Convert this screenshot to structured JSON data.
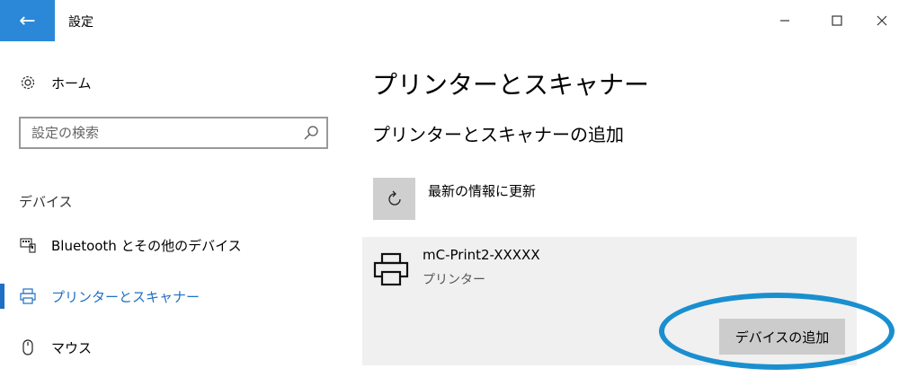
{
  "window": {
    "title": "設定",
    "back_icon": "back-arrow-icon",
    "minimize_icon": "minimize-icon",
    "maximize_icon": "maximize-icon",
    "close_icon": "close-icon"
  },
  "sidebar": {
    "home": {
      "icon": "gear-icon",
      "label": "ホーム"
    },
    "search": {
      "placeholder": "設定の検索",
      "icon": "search-icon"
    },
    "section_label": "デバイス",
    "items": [
      {
        "icon": "keyboard-icon",
        "label": "Bluetooth とその他のデバイス",
        "active": false
      },
      {
        "icon": "printer-icon",
        "label": "プリンターとスキャナー",
        "active": true
      },
      {
        "icon": "mouse-icon",
        "label": "マウス",
        "active": false
      }
    ],
    "active_color": "#1f6fc4"
  },
  "main": {
    "title": "プリンターとスキャナー",
    "subtitle": "プリンターとスキャナーの追加",
    "refresh": {
      "icon": "refresh-icon",
      "label": "最新の情報に更新"
    },
    "device": {
      "icon": "printer-icon",
      "name": "mC-Print2-XXXXX",
      "type": "プリンター",
      "add_button_label": "デバイスの追加"
    }
  },
  "colors": {
    "accent": "#2b88d8",
    "highlight_ring": "#1a8fd0"
  }
}
